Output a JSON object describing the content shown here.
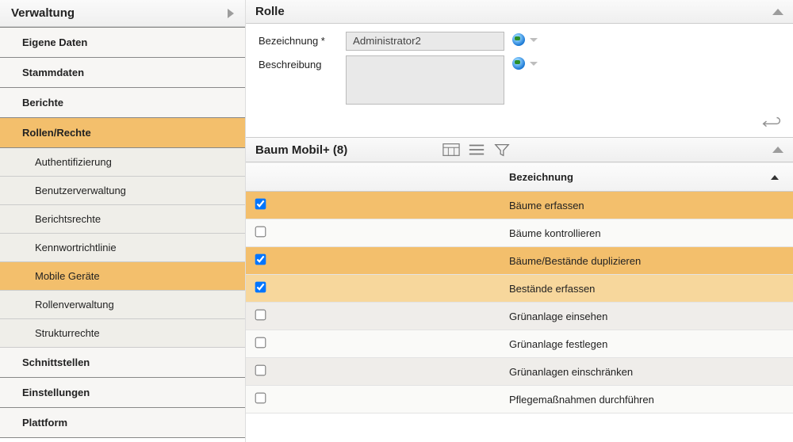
{
  "sidebar": {
    "title": "Verwaltung",
    "items": [
      {
        "label": "Eigene Daten",
        "active": false
      },
      {
        "label": "Stammdaten",
        "active": false
      },
      {
        "label": "Berichte",
        "active": false
      },
      {
        "label": "Rollen/Rechte",
        "active": true,
        "children": [
          {
            "label": "Authentifizierung",
            "active": false
          },
          {
            "label": "Benutzerverwaltung",
            "active": false
          },
          {
            "label": "Berichtsrechte",
            "active": false
          },
          {
            "label": "Kennwortrichtlinie",
            "active": false
          },
          {
            "label": "Mobile Geräte",
            "active": true
          },
          {
            "label": "Rollenverwaltung",
            "active": false
          },
          {
            "label": "Strukturrechte",
            "active": false
          }
        ]
      },
      {
        "label": "Schnittstellen",
        "active": false
      },
      {
        "label": "Einstellungen",
        "active": false
      },
      {
        "label": "Plattform",
        "active": false
      }
    ]
  },
  "rolle": {
    "section_title": "Rolle",
    "label_bezeichnung": "Bezeichnung *",
    "value_bezeichnung": "Administrator2",
    "label_beschreibung": "Beschreibung",
    "value_beschreibung": ""
  },
  "permissions": {
    "section_title": "Baum Mobil+ (8)",
    "column_label": "Bezeichnung",
    "rows": [
      {
        "checked": true,
        "label": "Bäume erfassen"
      },
      {
        "checked": false,
        "label": "Bäume kontrollieren"
      },
      {
        "checked": true,
        "label": "Bäume/Bestände duplizieren"
      },
      {
        "checked": true,
        "label": "Bestände erfassen"
      },
      {
        "checked": false,
        "label": "Grünanlage einsehen"
      },
      {
        "checked": false,
        "label": "Grünanlage festlegen"
      },
      {
        "checked": false,
        "label": "Grünanlagen einschränken"
      },
      {
        "checked": false,
        "label": "Pflegemaßnahmen durchführen"
      }
    ]
  }
}
